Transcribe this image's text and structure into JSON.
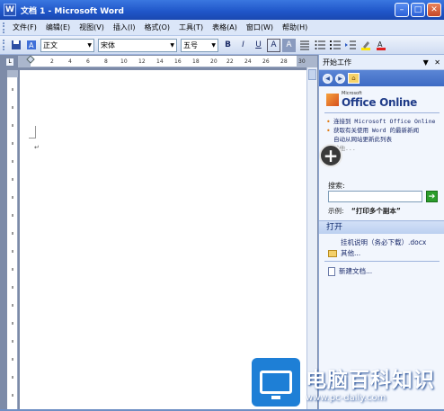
{
  "window": {
    "title": "文档 1 - Microsoft Word",
    "app_icon": "W"
  },
  "menu": {
    "items": [
      "文件(F)",
      "编辑(E)",
      "视图(V)",
      "插入(I)",
      "格式(O)",
      "工具(T)",
      "表格(A)",
      "窗口(W)",
      "帮助(H)"
    ]
  },
  "toolbar": {
    "style": "正文",
    "font": "宋体",
    "size": "五号",
    "bold": "B",
    "italic": "I",
    "underline": "U",
    "font_a": "A",
    "char_a": "A"
  },
  "ruler": {
    "h_ticks": [
      "2",
      "4",
      "6",
      "8",
      "10",
      "12",
      "14",
      "16",
      "18",
      "20",
      "22",
      "24",
      "26",
      "28",
      "30"
    ],
    "corner": "L"
  },
  "taskpane": {
    "title": "开始工作",
    "brand_small": "Microsoft",
    "brand_big": "Office Online",
    "links": [
      "连接到 Microsoft Office Online",
      "获取有关使用 Word 的最新新闻",
      "自动从网站更新此列表",
      "其他..."
    ],
    "search_label": "搜索:",
    "example_label": "示例:",
    "example_value": "“打印多个副本”",
    "open_section": "打开",
    "recent_doc": "挂机说明（务必下载）.docx",
    "other": "其他...",
    "new_doc": "新建文档..."
  },
  "watermark": {
    "cn": "电脑百科知识",
    "url": "www.pc-daily.com"
  },
  "colors": {
    "titlebar": "#1f55c8",
    "menubar": "#dbe6f8",
    "taskpane": "#f2f6fd",
    "watermark_blue": "#1e7fd6"
  }
}
